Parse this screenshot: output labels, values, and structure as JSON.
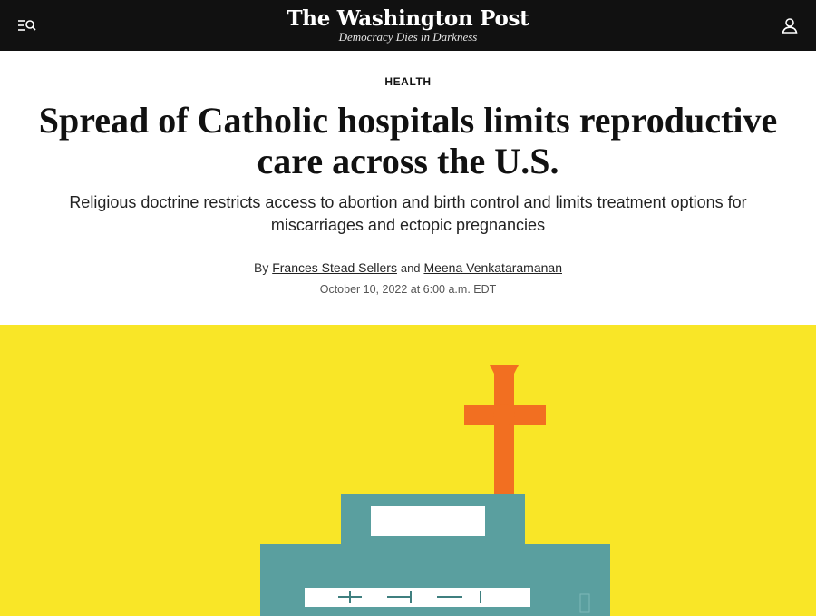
{
  "header": {
    "logo_text": "The Washington Post",
    "tagline": "Democracy Dies in Darkness",
    "menu_icon": "menu-search-icon",
    "account_icon": "user-icon"
  },
  "article": {
    "section": "HEALTH",
    "headline_line1": "Spread of Catholic hospitals limits reproductive",
    "headline_line2": "care across the U.S.",
    "dek_line1": "Religious doctrine restricts access to abortion and birth control and limits treatment options for",
    "dek_line2": "miscarriages and ectopic pregnancies",
    "byline_prefix": "By",
    "author1": "Frances Stead Sellers",
    "byline_and": "and",
    "author2": "Meena Venkataramanan",
    "timestamp": "October 10, 2022 at 6:00 a.m. EDT"
  },
  "colors": {
    "header_bg": "#111111",
    "illustration_bg": "#f9e627",
    "cross": "#f26f21",
    "building": "#5a9f9f"
  }
}
